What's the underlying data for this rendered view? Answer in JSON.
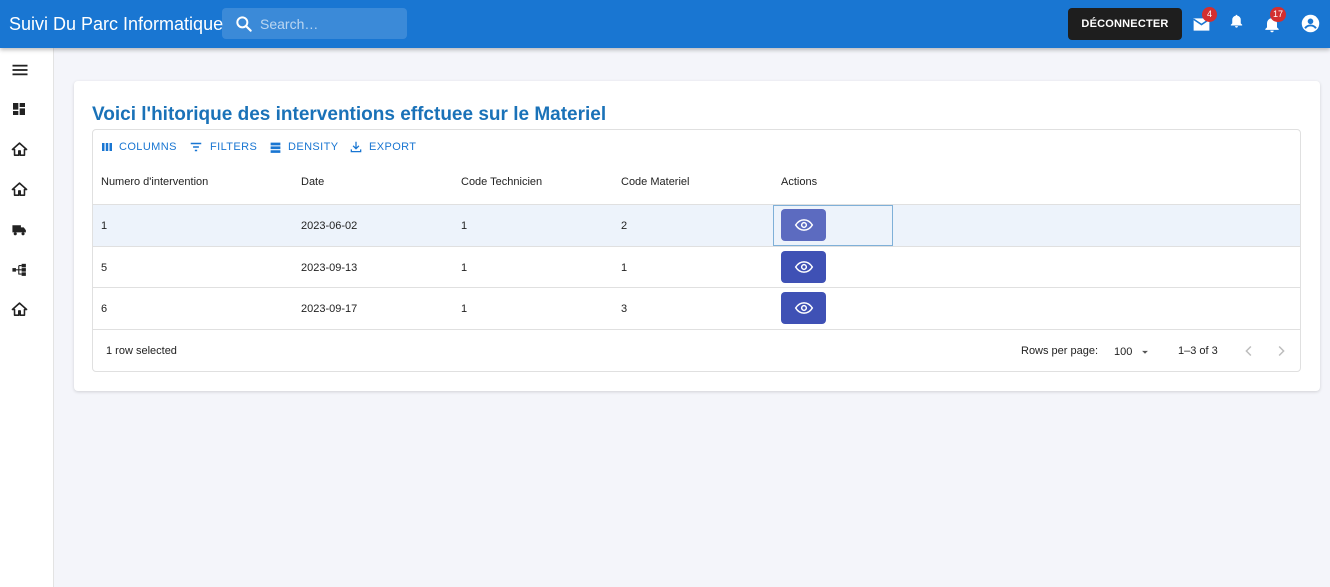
{
  "appbar": {
    "title": "Suivi Du Parc Informatique",
    "search_placeholder": "Search…",
    "logout_label": "DÉCONNECTER",
    "mail_count": "4",
    "notification_count": "17",
    "colors": {
      "appbar": "#1976d2",
      "badge": "#d32f2f"
    }
  },
  "sidebar": {
    "items": [
      {
        "icon": "menu-icon"
      },
      {
        "icon": "dashboard-icon"
      },
      {
        "icon": "home-icon"
      },
      {
        "icon": "home-icon"
      },
      {
        "icon": "truck-icon"
      },
      {
        "icon": "hierarchy-icon"
      },
      {
        "icon": "home-icon"
      }
    ]
  },
  "page": {
    "title": "Voici l'hitorique des interventions effctuee sur le Materiel"
  },
  "toolbar": {
    "columns": "COLUMNS",
    "filters": "FILTERS",
    "density": "DENSITY",
    "export": "EXPORT"
  },
  "table": {
    "headers": [
      "Numero d'intervention",
      "Date",
      "Code Technicien",
      "Code Materiel",
      "Actions"
    ],
    "rows": [
      {
        "numero": "1",
        "date": "2023-06-02",
        "technicien": "1",
        "materiel": "2",
        "selected": true
      },
      {
        "numero": "5",
        "date": "2023-09-13",
        "technicien": "1",
        "materiel": "1",
        "selected": false
      },
      {
        "numero": "6",
        "date": "2023-09-17",
        "technicien": "1",
        "materiel": "3",
        "selected": false
      }
    ],
    "action_icon": "eye-icon"
  },
  "footer": {
    "selection": "1 row selected",
    "rows_per_page_label": "Rows per page:",
    "rows_per_page_value": "100",
    "range": "1–3 of 3"
  }
}
